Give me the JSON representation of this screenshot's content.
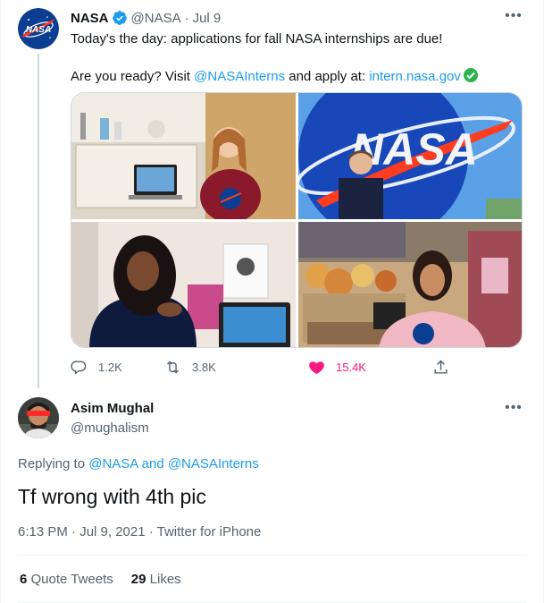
{
  "parent_tweet": {
    "author_name": "NASA",
    "handle": "@NASA",
    "date": "Jul 9",
    "separator": "·",
    "more_label": "•••",
    "text_line1": "Today's the day: applications for fall NASA internships are due!",
    "text_line2_pre": "Are you ready? Visit ",
    "mention": "@NASAInterns",
    "text_line2_mid": " and apply at: ",
    "url": "intern.nasa.gov",
    "media_count": 4,
    "avatar_logo_text": "NASA",
    "photo_logo_text": "NASA",
    "replies": "1.2K",
    "retweets": "3.8K",
    "likes": "15.4K",
    "liked": true
  },
  "reply_tweet": {
    "author_name": "Asim Mughal",
    "handle": "@mughalism",
    "more_label": "•••",
    "replying_prefix": "Replying to ",
    "replying_to": "@NASA and @NASAInterns",
    "text": "Tf wrong with 4th pic",
    "meta": "6:13 PM · Jul 9, 2021 · Twitter for iPhone",
    "quote_tweets_count": "6",
    "quote_tweets_label": " Quote Tweets",
    "likes_count": "29",
    "likes_label": " Likes"
  },
  "colors": {
    "accent": "#1d9bf0",
    "like": "#f91880",
    "muted": "#536471",
    "text": "#0f1419",
    "nasa_blue": "#0b3d91",
    "nasa_red": "#fc3d21"
  },
  "icons": [
    "verified-badge-icon",
    "more-icon",
    "reply-icon",
    "retweet-icon",
    "like-icon",
    "share-icon",
    "check-mark-emoji-icon"
  ]
}
